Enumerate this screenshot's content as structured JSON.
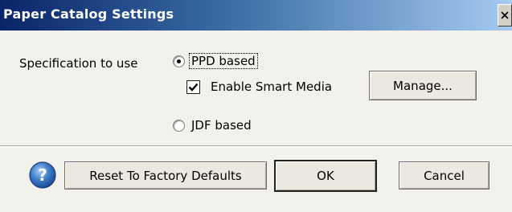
{
  "window": {
    "title": "Paper Catalog Settings",
    "close_symbol": "X"
  },
  "spec": {
    "label": "Specification to use",
    "options": [
      {
        "label": "PPD based",
        "selected": true
      },
      {
        "label": "JDF based",
        "selected": false
      }
    ],
    "smart_media": {
      "label": "Enable Smart Media",
      "checked": true
    },
    "manage_label": "Manage..."
  },
  "footer": {
    "help_icon": "question-mark-icon",
    "reset_label": "Reset To Factory Defaults",
    "ok_label": "OK",
    "cancel_label": "Cancel"
  }
}
